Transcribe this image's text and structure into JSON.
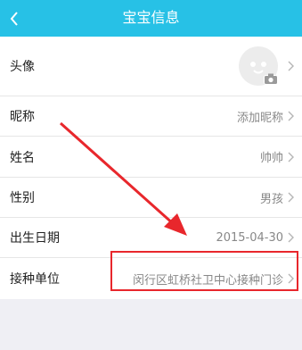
{
  "header": {
    "title": "宝宝信息",
    "back_icon": "chevron-left-icon"
  },
  "rows": [
    {
      "label": "头像",
      "avatar_icon": "baby-face-icon",
      "camera_icon": "camera-icon"
    },
    {
      "label": "昵称",
      "value": "添加昵称"
    },
    {
      "label": "姓名",
      "value": "帅帅"
    },
    {
      "label": "性别",
      "value": "男孩"
    },
    {
      "label": "出生日期",
      "value": "2015-04-30"
    },
    {
      "label": "接种单位",
      "value": "闵行区虹桥社卫中心接种门诊"
    }
  ],
  "colors": {
    "header_bg": "#27c1e6",
    "annotation": "#e8272c",
    "page_bg": "#efeff4"
  },
  "annotation": {
    "arrow_icon": "red-arrow-icon",
    "box": "highlight-box"
  }
}
